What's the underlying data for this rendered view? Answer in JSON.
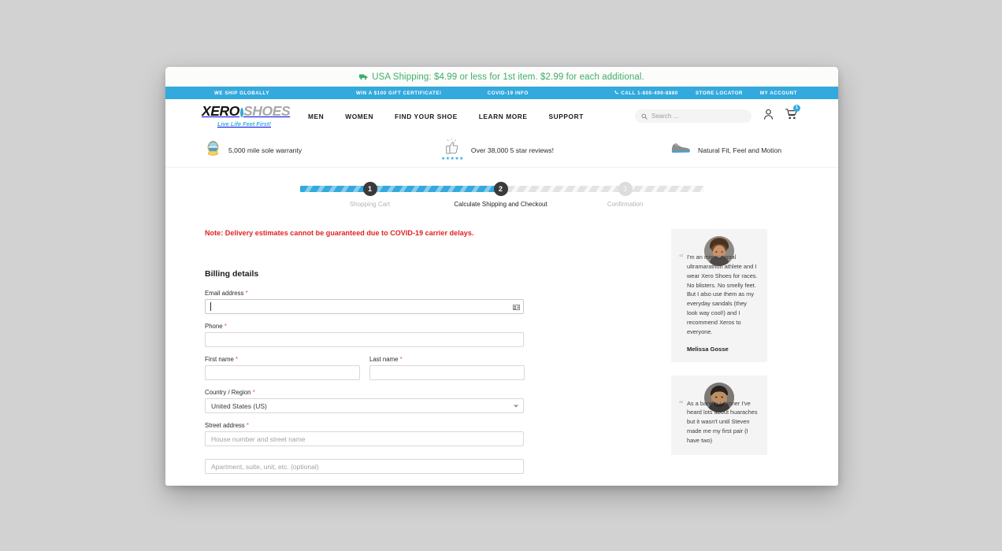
{
  "announcement": {
    "icon": "truck-icon",
    "text": "USA Shipping: $4.99 or less for 1st item. $2.99 for each additional.",
    "color": "#3fae6c"
  },
  "utility_bar": {
    "background": "#34a9dd",
    "left_links": [
      "WE SHIP GLOBALLY",
      "WIN A $100 GIFT CERTIFICATE!",
      "COVID-19 INFO"
    ],
    "phone": "CALL 1-800-499-8880",
    "right_links": [
      "STORE LOCATOR",
      "MY ACCOUNT"
    ]
  },
  "header": {
    "logo": {
      "part1": "XERO",
      "part2": "SHOES",
      "tagline": "Live Life Feet First!"
    },
    "nav": [
      "MEN",
      "WOMEN",
      "FIND YOUR SHOE",
      "LEARN MORE",
      "SUPPORT"
    ],
    "search": {
      "placeholder": "Search ...",
      "value": ""
    },
    "account_icon": "user-icon",
    "cart_icon": "cart-icon",
    "cart_count": "1",
    "cart_badge_color": "#34a9dd"
  },
  "trust_badges": [
    {
      "icon": "warranty-seal-icon",
      "label": "5,000 mile sole warranty"
    },
    {
      "icon": "thumbs-up-icon",
      "label": "Over 38,000 5 star reviews!",
      "stars": "★★★★★"
    },
    {
      "icon": "shoe-icon",
      "label": "Natural Fit, Feel and Motion"
    }
  ],
  "stepper": {
    "steps": [
      {
        "number": "1",
        "label": "Shopping Cart",
        "state": "complete"
      },
      {
        "number": "2",
        "label": "Calculate Shipping and Checkout",
        "state": "current"
      },
      {
        "number": "3",
        "label": "Confirmation",
        "state": "upcoming"
      }
    ],
    "active_color": "#34a9dd",
    "inactive_color": "#e3e3e3"
  },
  "notice": {
    "text": "Note: Delivery estimates cannot be guaranteed due to COVID-19 carrier delays.",
    "color": "#e02020"
  },
  "billing": {
    "title": "Billing details",
    "required_marker": "*",
    "fields": {
      "email": {
        "label": "Email address",
        "value": "",
        "placeholder": "",
        "required": true,
        "focused": true
      },
      "phone": {
        "label": "Phone",
        "value": "",
        "placeholder": "",
        "required": true
      },
      "first_name": {
        "label": "First name",
        "value": "",
        "placeholder": "",
        "required": true
      },
      "last_name": {
        "label": "Last name",
        "value": "",
        "placeholder": "",
        "required": true
      },
      "country": {
        "label": "Country / Region",
        "value": "United States (US)",
        "required": true
      },
      "street": {
        "label": "Street address",
        "value": "",
        "placeholder": "House number and street name",
        "required": true
      },
      "street2": {
        "label": "",
        "value": "",
        "placeholder": "Apartment, suite, unit, etc. (optional)",
        "required": false
      }
    }
  },
  "testimonials": [
    {
      "avatar": "avatar-melissa",
      "quote": "I'm an international ultramarathon athlete and I wear Xero Shoes for races. No blisters. No smelly feet. But I also use them as my everyday sandals (they look way cool!) and I recommend Xeros to everyone.",
      "name": "Melissa Gosse"
    },
    {
      "avatar": "avatar-steven-reviewer",
      "quote": "As a barefoot runner I've heard lots about huaraches but it wasn't until Steven made me my first pair (I have two)",
      "name": ""
    }
  ]
}
